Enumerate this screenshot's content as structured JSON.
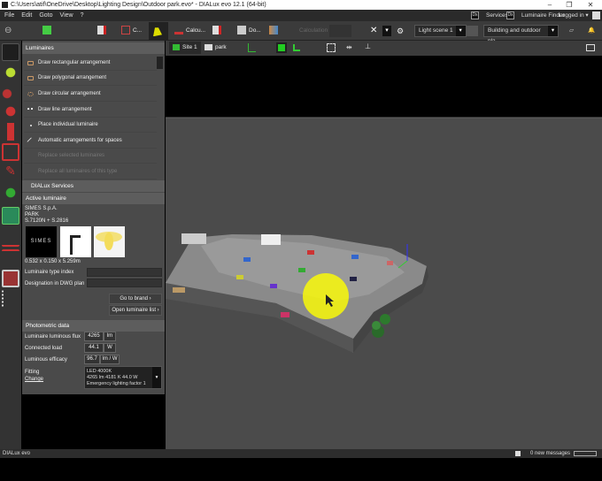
{
  "window": {
    "title": "C:\\Users\\atif\\OneDrive\\Desktop\\Lighting Design\\Outdoor park.evo* - DIALux evo 12.1  (64-bit)",
    "minimize": "–",
    "restore": "❐",
    "close": "✕"
  },
  "menu": [
    "File",
    "Edit",
    "Goto",
    "View",
    "?"
  ],
  "topright": {
    "services": "Services",
    "luminaire_finder": "Luminaire Finder",
    "logged_in": "Logged in ▾",
    "dx": "Dx"
  },
  "toolbar": {
    "construction": "C...",
    "calculation": "Calcu...",
    "documentation": "Do...",
    "calc_objects": "Calculation",
    "light_scene": "Light scene 1",
    "view_mode": "Building and outdoor pla..."
  },
  "toolbar2": {
    "site": "Site 1",
    "park": "park"
  },
  "panel": {
    "luminaires_header": "Luminaires",
    "items": [
      "Draw rectangular arrangement",
      "Draw polygonal arrangement",
      "Draw circular arrangement",
      "Draw line arrangement",
      "Place individual luminaire",
      "Automatic arrangements for spaces",
      "Replace selected luminaires",
      "Replace all luminaires of this type"
    ],
    "services_header": "DIALux Services",
    "active_header": "Active luminaire",
    "manufacturer": "SIMES S.p.A.",
    "family": "PARK",
    "article": "S.7120N + S.2816",
    "brand_logo": "SIMES",
    "dimensions": "0.532 x 0.150 x 5.259m",
    "type_index_label": "Luminaire type index",
    "type_index_value": "",
    "dwg_label": "Designation in DWG plan",
    "dwg_value": "",
    "go_to_brand": "Go to brand",
    "open_list": "Open luminaire list",
    "photometric_header": "Photometric data",
    "flux_label": "Luminaire luminous flux",
    "flux_value": "4265",
    "flux_unit": "lm",
    "load_label": "Connected load",
    "load_value": "44.1",
    "load_unit": "W",
    "efficacy_label": "Luminous efficacy",
    "efficacy_value": "96.7",
    "efficacy_unit": "lm / W",
    "fitting_label": "Fitting",
    "change_label": "Change",
    "fitting_lines": [
      "LED 4000K",
      "4265 lm   4181 K   44.0 W",
      "Emergency lighting factor 1"
    ]
  },
  "status": {
    "brand": "DIALux evo",
    "messages": "0 new messages"
  },
  "colors": {
    "accent": "#f0e600",
    "highlight": "#ffff00"
  }
}
